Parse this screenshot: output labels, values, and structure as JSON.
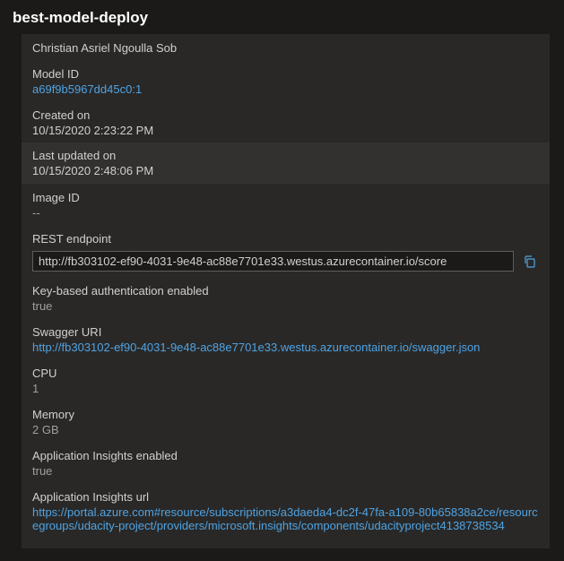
{
  "title": "best-model-deploy",
  "owner": {
    "value": "Christian Asriel Ngoulla Sob"
  },
  "model_id": {
    "label": "Model ID",
    "value": "a69f9b5967dd45c0:1"
  },
  "created_on": {
    "label": "Created on",
    "value": "10/15/2020 2:23:22 PM"
  },
  "last_updated": {
    "label": "Last updated on",
    "value": "10/15/2020 2:48:06 PM"
  },
  "image_id": {
    "label": "Image ID",
    "value": "--"
  },
  "rest_endpoint": {
    "label": "REST endpoint",
    "value": "http://fb303102-ef90-4031-9e48-ac88e7701e33.westus.azurecontainer.io/score"
  },
  "key_auth": {
    "label": "Key-based authentication enabled",
    "value": "true"
  },
  "swagger": {
    "label": "Swagger URI",
    "value": "http://fb303102-ef90-4031-9e48-ac88e7701e33.westus.azurecontainer.io/swagger.json"
  },
  "cpu": {
    "label": "CPU",
    "value": "1"
  },
  "memory": {
    "label": "Memory",
    "value": "2 GB"
  },
  "appinsights_enabled": {
    "label": "Application Insights enabled",
    "value": "true"
  },
  "appinsights_url": {
    "label": "Application Insights url",
    "value": "https://portal.azure.com#resource/subscriptions/a3daeda4-dc2f-47fa-a109-80b65838a2ce/resourcegroups/udacity-project/providers/microsoft.insights/components/udacityproject4138738534"
  }
}
